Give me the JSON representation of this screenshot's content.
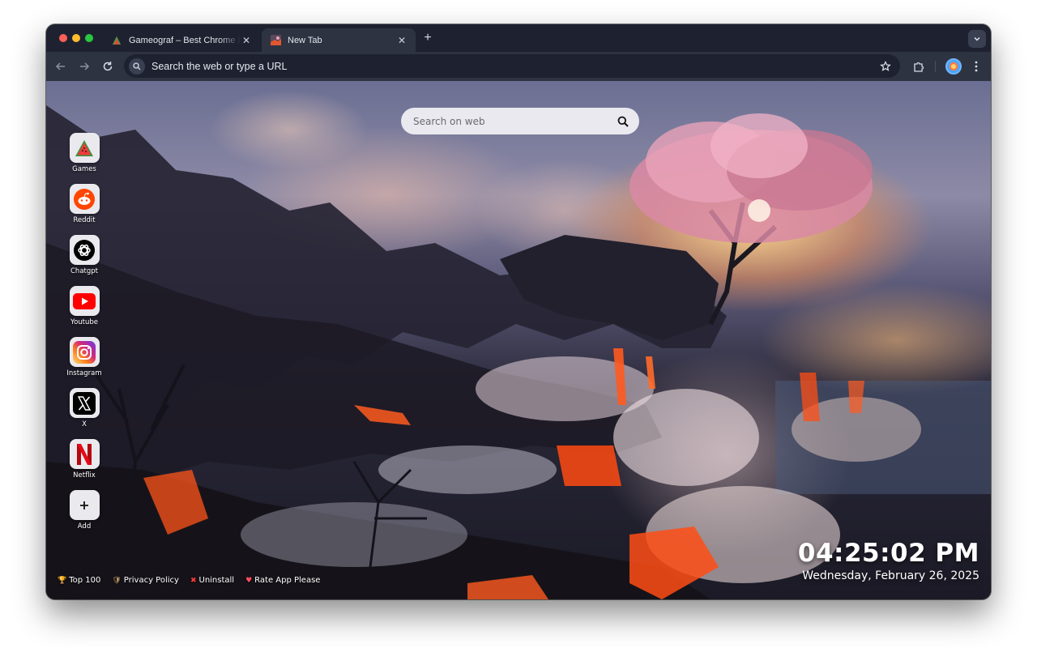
{
  "browser": {
    "tabs": [
      {
        "title": "Gameograf – Best Chrome Li",
        "active": false,
        "favicon": "watermelon-icon"
      },
      {
        "title": "New Tab",
        "active": true,
        "favicon": "lava-wallpaper-icon"
      }
    ],
    "omnibox": {
      "placeholder": "Search the web or type a URL"
    }
  },
  "newtab": {
    "search": {
      "placeholder": "Search on web"
    },
    "shortcuts": [
      {
        "label": "Games",
        "icon": "watermelon-icon"
      },
      {
        "label": "Reddit",
        "icon": "reddit-icon"
      },
      {
        "label": "Chatgpt",
        "icon": "chatgpt-icon"
      },
      {
        "label": "Youtube",
        "icon": "youtube-icon"
      },
      {
        "label": "Instagram",
        "icon": "instagram-icon"
      },
      {
        "label": "X",
        "icon": "x-icon"
      },
      {
        "label": "Netflix",
        "icon": "netflix-icon"
      },
      {
        "label": "Add",
        "icon": "plus-icon"
      }
    ],
    "footer_links": [
      {
        "label": "Top 100",
        "icon": "trophy-icon"
      },
      {
        "label": "Privacy Policy",
        "icon": "shield-icon"
      },
      {
        "label": "Uninstall",
        "icon": "cross-icon"
      },
      {
        "label": "Rate App Please",
        "icon": "heart-icon"
      }
    ],
    "clock": {
      "time": "04:25:02 PM",
      "date": "Wednesday, February 26, 2025"
    }
  },
  "colors": {
    "youtube_red": "#ff0000",
    "netflix_red": "#e50914",
    "reddit_orange": "#ff4500"
  }
}
